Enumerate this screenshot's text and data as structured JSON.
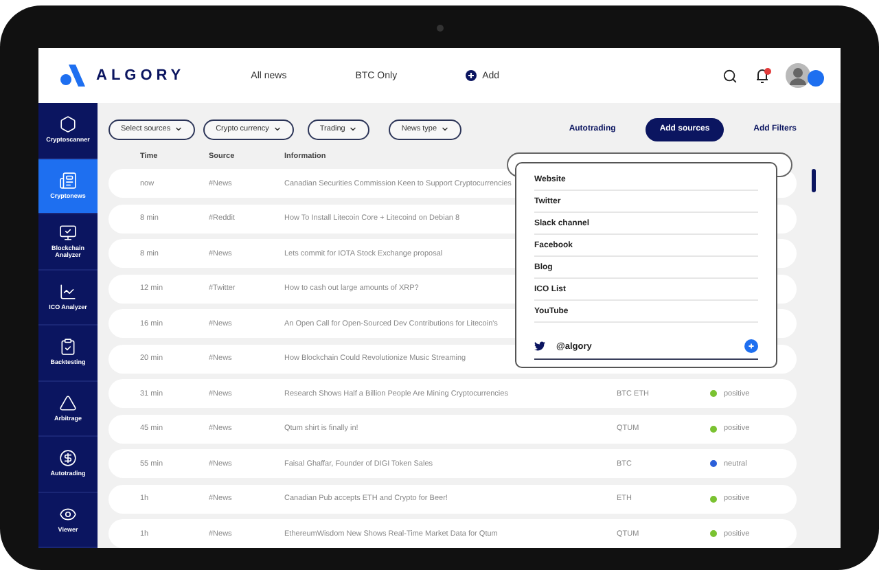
{
  "header": {
    "logo": "ALGORY",
    "nav": [
      {
        "label": "All news"
      },
      {
        "label": "BTC Only"
      }
    ],
    "add": "Add"
  },
  "sidebar": {
    "items": [
      {
        "label": "Cryptoscanner",
        "selected": false
      },
      {
        "label": "Cryptonews",
        "selected": true
      },
      {
        "label": "Blockchain Analyzer",
        "selected": false
      },
      {
        "label": "ICO Analyzer",
        "selected": false
      },
      {
        "label": "Backtesting",
        "selected": false
      },
      {
        "label": "Arbitrage",
        "selected": false
      },
      {
        "label": "Autotrading",
        "selected": false
      },
      {
        "label": "Viewer",
        "selected": false
      }
    ]
  },
  "filters": {
    "dropdowns": [
      "Select sources",
      "Crypto currency",
      "Trading",
      "News type"
    ],
    "autotrading": "Autotrading",
    "add_sources": "Add sources",
    "add_filters": "Add Filters"
  },
  "table": {
    "columns": [
      "Time",
      "Source",
      "Information"
    ],
    "rows": [
      {
        "time": "now",
        "source": "#News",
        "information": "Canadian Securities Commission Keen to Support Cryptocurrencies"
      },
      {
        "time": "8 min",
        "source": "#Reddit",
        "information": "How To Install Litecoin Core + Litecoind on Debian 8"
      },
      {
        "time": "8 min",
        "source": "#News",
        "information": "Lets commit for IOTA Stock Exchange proposal"
      },
      {
        "time": "12 min",
        "source": "#Twitter",
        "information": "How to cash out large amounts of XRP?"
      },
      {
        "time": "16 min",
        "source": "#News",
        "information": "An Open Call for Open-Sourced Dev Contributions for Litecoin's"
      },
      {
        "time": "20 min",
        "source": "#News",
        "information": "How Blockchain Could Revolutionize Music Streaming"
      },
      {
        "time": "31 min",
        "source": "#News",
        "information": "Research Shows Half a Billion People Are Mining Cryptocurrencies",
        "currency": "BTC ETH",
        "sentiment": "positive",
        "color": "#7ac231"
      },
      {
        "time": "45 min",
        "source": "#News",
        "information": "Qtum shirt is finally in!",
        "currency": "QTUM",
        "sentiment": "positive",
        "color": "#7ac231"
      },
      {
        "time": "55 min",
        "source": "#News",
        "information": "Faisal Ghaffar, Founder of DIGI Token Sales",
        "currency": "BTC",
        "sentiment": "neutral",
        "color": "#2b5fd9"
      },
      {
        "time": "1h",
        "source": "#News",
        "information": "Canadian Pub accepts ETH and Crypto for Beer!",
        "currency": "ETH",
        "sentiment": "positive",
        "color": "#7ac231"
      },
      {
        "time": "1h",
        "source": "#News",
        "information": "EthereumWisdom New Shows Real-Time Market Data for Qtum",
        "currency": "QTUM",
        "sentiment": "positive",
        "color": "#7ac231"
      }
    ]
  },
  "sources_menu": {
    "items": [
      "Website",
      "Twitter",
      "Slack channel",
      "Facebook",
      "Blog",
      "ICO List",
      "YouTube"
    ],
    "handle_field": {
      "value": "@algory"
    }
  }
}
